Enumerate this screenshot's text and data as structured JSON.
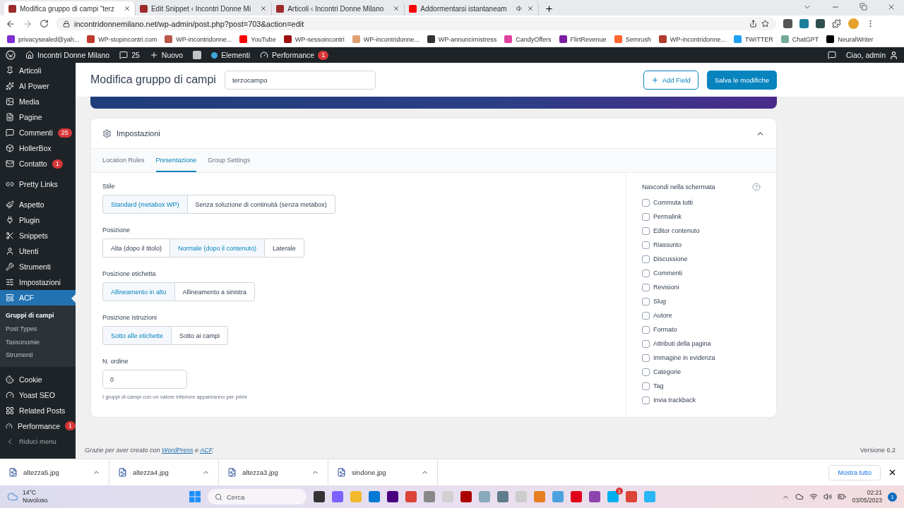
{
  "browser": {
    "tabs": [
      {
        "title": "Modifica gruppo di campi “terz",
        "selected": true,
        "kind": "page"
      },
      {
        "title": "Edit Snippet ‹ Incontri Donne Mi",
        "selected": false,
        "kind": "page"
      },
      {
        "title": "Articoli ‹ Incontri Donne Milano",
        "selected": false,
        "kind": "page"
      },
      {
        "title": "Addormentarsi istantaneam",
        "selected": false,
        "kind": "video"
      }
    ],
    "url": "incontridonnemilano.net/wp-admin/post.php?post=703&action=edit",
    "bookmarks": [
      {
        "label": "privacysealed@yah...",
        "color": "#7b2fd0"
      },
      {
        "label": "WP-stopincontri.com",
        "color": "#c0392b"
      },
      {
        "label": "WP-incontridonne...",
        "color": "#b8574a"
      },
      {
        "label": "YouTube",
        "color": "#ff0000"
      },
      {
        "label": "WP-sessoincontri",
        "color": "#a01010"
      },
      {
        "label": "WP-incontridonne...",
        "color": "#e0a070"
      },
      {
        "label": "WP-annuncimistress",
        "color": "#333333"
      },
      {
        "label": "CandyOffers",
        "color": "#e040a0"
      },
      {
        "label": "FlirtRevenue",
        "color": "#7b1fa2"
      },
      {
        "label": "Semrush",
        "color": "#ff642d"
      },
      {
        "label": "WP-incontridonne...",
        "color": "#b03a2e"
      },
      {
        "label": "TWITTER",
        "color": "#1da1f2"
      },
      {
        "label": "ChatGPT",
        "color": "#74aa9c"
      },
      {
        "label": "NeuralWriter",
        "color": "#000000"
      }
    ]
  },
  "admin_bar": {
    "site": "Incontri Donne Milano",
    "comments": "25",
    "new": "Nuovo",
    "elementi": "Elementi",
    "performance": "Performance",
    "performance_badge": "1",
    "greeting": "Ciao, admin"
  },
  "sidebar": {
    "groups": [
      [
        {
          "label": "Articoli",
          "selected": false
        },
        {
          "label": "AI Power",
          "selected": false
        },
        {
          "label": "Media",
          "selected": false
        },
        {
          "label": "Pagine",
          "selected": false
        },
        {
          "label": "Commenti",
          "badge": "25",
          "selected": false
        },
        {
          "label": "HollerBox",
          "selected": false
        },
        {
          "label": "Contatto",
          "badge": "1",
          "selected": false
        }
      ],
      [
        {
          "label": "Pretty Links",
          "selected": false
        }
      ],
      [
        {
          "label": "Aspetto",
          "selected": false
        },
        {
          "label": "Plugin",
          "selected": false
        },
        {
          "label": "Snippets",
          "selected": false
        },
        {
          "label": "Utenti",
          "selected": false
        },
        {
          "label": "Strumenti",
          "selected": false
        },
        {
          "label": "Impostazioni",
          "selected": false
        },
        {
          "label": "ACF",
          "selected": true,
          "children": [
            {
              "label": "Gruppi di campi",
              "selected": true
            },
            {
              "label": "Post Types",
              "selected": false
            },
            {
              "label": "Tassonomie",
              "selected": false
            },
            {
              "label": "Strumenti",
              "selected": false
            }
          ]
        }
      ],
      [
        {
          "label": "Cookie",
          "selected": false
        },
        {
          "label": "Yoast SEO",
          "selected": false
        },
        {
          "label": "Related Posts",
          "selected": false
        },
        {
          "label": "Performance",
          "badge": "1",
          "selected": false
        }
      ]
    ],
    "collapse": "Riduci menu"
  },
  "header": {
    "title": "Modifica gruppo di campi",
    "name_value": "terzocampo",
    "add_button": "Add Field",
    "save_button": "Salva le modifiche"
  },
  "settings": {
    "title": "Impostazioni",
    "expanded": true,
    "tabs": [
      {
        "label": "Location Rules",
        "selected": false
      },
      {
        "label": "Presentazione",
        "selected": true
      },
      {
        "label": "Group Settings",
        "selected": false
      }
    ],
    "fields": [
      {
        "label": "Stile",
        "options": [
          {
            "label": "Standard (metabox WP)",
            "selected": true
          },
          {
            "label": "Senza soluzione di continuità (senza metabox)",
            "selected": false
          }
        ]
      },
      {
        "label": "Posizione",
        "options": [
          {
            "label": "Alta (dopo il titolo)",
            "selected": false
          },
          {
            "label": "Normale (dopo il contenuto)",
            "selected": true
          },
          {
            "label": "Laterale",
            "selected": false
          }
        ]
      },
      {
        "label": "Posizione etichetta",
        "options": [
          {
            "label": "Allineamento in alto",
            "selected": true
          },
          {
            "label": "Allineamento a sinistra",
            "selected": false
          }
        ]
      },
      {
        "label": "Posizione istruzioni",
        "options": [
          {
            "label": "Sotto alle etichette",
            "selected": true
          },
          {
            "label": "Sotto ai campi",
            "selected": false
          }
        ]
      }
    ],
    "order": {
      "label": "N. ordine",
      "value": "0",
      "help": "I gruppi di campi con un valore inferiore appariranno per primi"
    },
    "hide": {
      "label": "Nascondi nella schermata",
      "items": [
        {
          "label": "Commuta tutti",
          "checked": false
        },
        {
          "label": "Permalink",
          "checked": false
        },
        {
          "label": "Editor contenuto",
          "checked": false
        },
        {
          "label": "Riassunto",
          "checked": false
        },
        {
          "label": "Discussione",
          "checked": false
        },
        {
          "label": "Commenti",
          "checked": false
        },
        {
          "label": "Revisioni",
          "checked": false
        },
        {
          "label": "Slug",
          "checked": false
        },
        {
          "label": "Autore",
          "checked": false
        },
        {
          "label": "Formato",
          "checked": false
        },
        {
          "label": "Attributi della pagina",
          "checked": false
        },
        {
          "label": "Immagine in evidenza",
          "checked": false
        },
        {
          "label": "Categorie",
          "checked": false
        },
        {
          "label": "Tag",
          "checked": false
        },
        {
          "label": "Invia trackback",
          "checked": false
        }
      ]
    }
  },
  "footer": {
    "parts": [
      {
        "kind": "text",
        "text": "Grazie per aver creato con "
      },
      {
        "kind": "link",
        "text": "WordPress"
      },
      {
        "kind": "text",
        "text": " e "
      },
      {
        "kind": "link",
        "text": "ACF"
      },
      {
        "kind": "text",
        "text": "."
      }
    ],
    "version": "Versione 6.2"
  },
  "downloads": {
    "files": [
      "altezza5.jpg",
      "altezza4.jpg",
      "altezza3.jpg",
      "sindone.jpg"
    ],
    "show_all": "Mostra tutto"
  },
  "taskbar": {
    "temperature": "14°C",
    "weather": "Nuvoloso",
    "search_placeholder": "Cerca",
    "skype_badge": "1",
    "time": "02:21",
    "date": "03/05/2023",
    "notifications": "1"
  }
}
